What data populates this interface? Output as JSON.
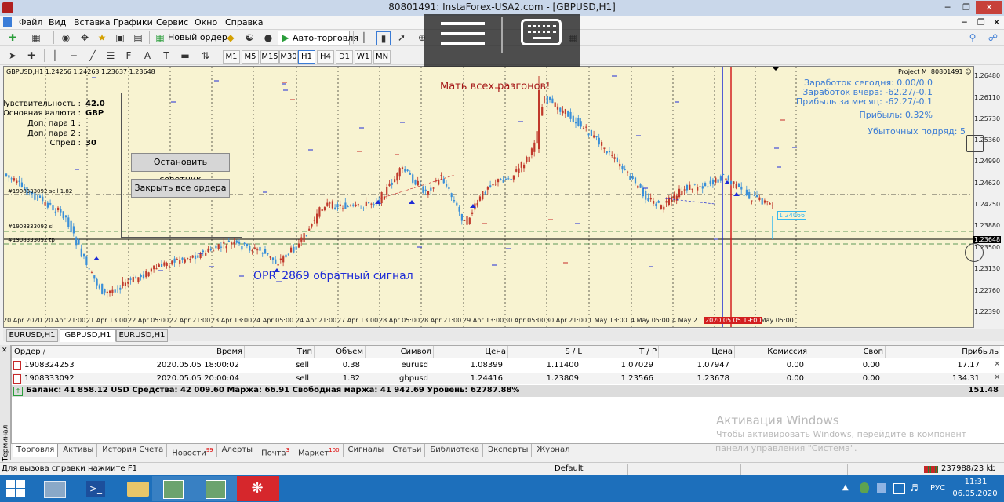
{
  "window": {
    "title": "80801491: InstaForex-USA2.com - [GBPUSD,H1]"
  },
  "menu": [
    "Файл",
    "Вид",
    "Вставка",
    "Графики",
    "Сервис",
    "Окно",
    "Справка"
  ],
  "toolbar": {
    "new_order": "Новый ордер",
    "autotrade": "Авто-торговля"
  },
  "timeframes": [
    "M1",
    "M5",
    "M15",
    "M30",
    "H1",
    "H4",
    "D1",
    "W1",
    "MN"
  ],
  "timeframe_active": "H1",
  "chart": {
    "header": "GBPUSD,H1  1.24256 1.24263 1.23637 1.23648",
    "annotation_top": "Мать всех разгонов!",
    "annotation_bottom": "OPR_2869 обратный сигнал",
    "account_name": "Project M",
    "account_id": "80801491",
    "stats": [
      "Заработок сегодня: 0.00/0.0",
      "Заработок вчера: -62.27/-0.1",
      "Прибыль за месяц: -62.27/-0.1",
      "Прибыль: 0.32%",
      "Убыточных подряд: 5"
    ],
    "ea_panel": {
      "rows": [
        {
          "label": "Чувствительность :",
          "value": "42.0"
        },
        {
          "label": "Основная валюта :",
          "value": "GBP"
        },
        {
          "label": "Доп. пара 1 :",
          "value": ""
        },
        {
          "label": "Доп. пара 2 :",
          "value": ""
        },
        {
          "label": "Спред :",
          "value": "30"
        }
      ],
      "stop_button": "Остановить советник",
      "close_button": "Закрыть все ордера"
    },
    "order_lines": [
      "#1908333092 sell 1.82",
      "#1908333092 sl",
      "#1908333092 tp"
    ],
    "price_labels": [
      "1.26480",
      "1.26110",
      "1.25730",
      "1.25360",
      "1.24990",
      "1.24620",
      "1.24250",
      "1.23880",
      "1.23648",
      "1.23500",
      "1.23130",
      "1.22760",
      "1.22390"
    ],
    "current_price": "1.23648",
    "box_price": "1.24066",
    "time_labels": [
      "20 Apr 2020",
      "20 Apr 21:00",
      "21 Apr 13:00",
      "22 Apr 05:00",
      "22 Apr 21:00",
      "23 Apr 13:00",
      "24 Apr 05:00",
      "24 Apr 21:00",
      "27 Apr 13:00",
      "28 Apr 05:00",
      "28 Apr 21:00",
      "29 Apr 13:00",
      "30 Apr 05:00",
      "30 Apr 21:00",
      "1 May 13:00",
      "4 May 05:00",
      "4 May 2",
      "5 May 05:00"
    ],
    "time_cursor": "2020.05.05 19:00"
  },
  "symbol_tabs": [
    "EURUSD,H1",
    "GBPUSD,H1",
    "EURUSD,H1"
  ],
  "symbol_tab_active": 1,
  "terminal": {
    "columns": [
      "Ордер",
      "Время",
      "Тип",
      "Объем",
      "Символ",
      "Цена",
      "S / L",
      "T / P",
      "Цена",
      "Комиссия",
      "Своп",
      "Прибыль"
    ],
    "rows": [
      [
        "1908324253",
        "2020.05.05 18:00:02",
        "sell",
        "0.38",
        "eurusd",
        "1.08399",
        "1.11400",
        "1.07029",
        "1.07947",
        "0.00",
        "0.00",
        "17.17"
      ],
      [
        "1908333092",
        "2020.05.05 20:00:04",
        "sell",
        "1.82",
        "gbpusd",
        "1.24416",
        "1.23809",
        "1.23566",
        "1.23678",
        "0.00",
        "0.00",
        "134.31"
      ]
    ],
    "balance": "Баланс: 41 858.12 USD  Средства: 42 009.60  Маржа: 66.91  Свободная маржа: 41 942.69  Уровень: 62787.88%",
    "balance_profit": "151.48",
    "side_label": "Терминал"
  },
  "terminal_tabs": [
    {
      "label": "Торговля",
      "badge": ""
    },
    {
      "label": "Активы",
      "badge": ""
    },
    {
      "label": "История Счета",
      "badge": ""
    },
    {
      "label": "Новости",
      "badge": "99"
    },
    {
      "label": "Алерты",
      "badge": ""
    },
    {
      "label": "Почта",
      "badge": "3"
    },
    {
      "label": "Маркет",
      "badge": "100"
    },
    {
      "label": "Сигналы",
      "badge": ""
    },
    {
      "label": "Статьи",
      "badge": ""
    },
    {
      "label": "Библиотека",
      "badge": ""
    },
    {
      "label": "Эксперты",
      "badge": ""
    },
    {
      "label": "Журнал",
      "badge": ""
    }
  ],
  "watermark": {
    "title": "Активация Windows",
    "line1": "Чтобы активировать Windows, перейдите в компонент",
    "line2": "панели управления \"Система\"."
  },
  "statusbar": {
    "help": "Для вызова справки нажмите F1",
    "profile": "Default",
    "traffic": "237988/23 kb"
  },
  "tray": {
    "lang": "РУС",
    "time": "11:31",
    "date": "06.05.2020"
  },
  "colors": {
    "chart_bg": "#f8f3d1",
    "bull": "#c0392b",
    "bear": "#3a8fd8",
    "accent": "#3a7bd5"
  }
}
